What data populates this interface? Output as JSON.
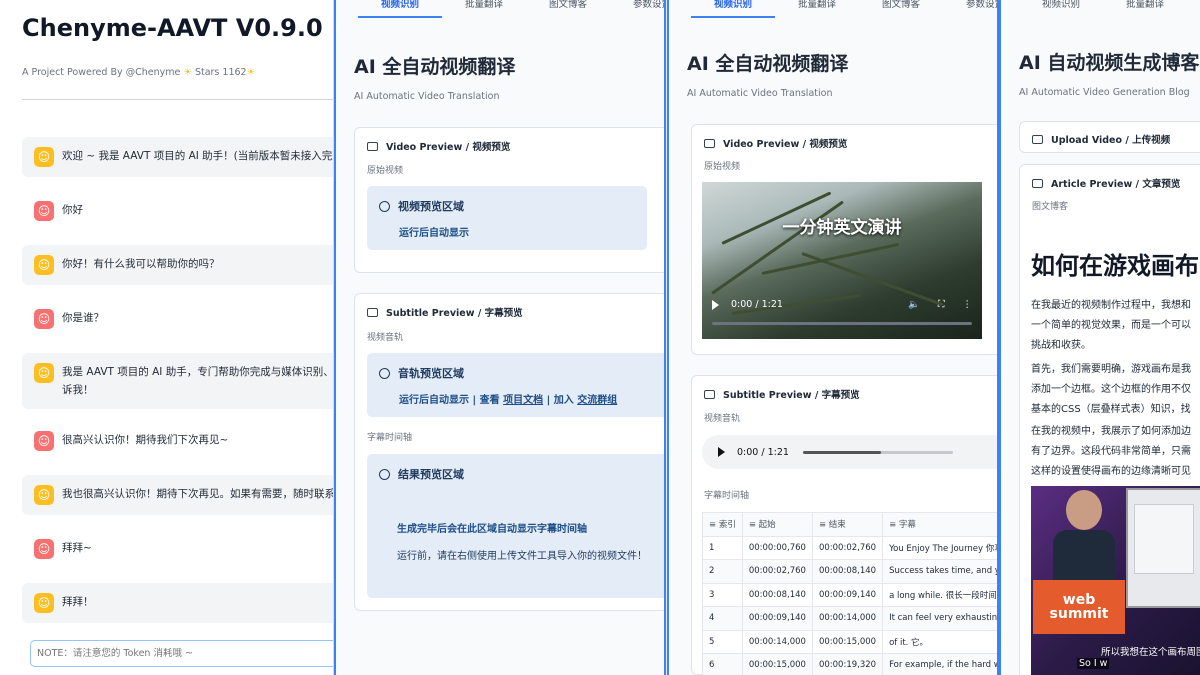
{
  "chat": {
    "app_title": "Chenyme-AAVT V0.9.0",
    "subtitle_prefix": "A Project Powered By @Chenyme",
    "star_glyph": "☀",
    "stars_text": "Stars 1162",
    "messages": [
      {
        "role": "bot",
        "text": "欢迎 ~ 我是 AAVT 项目的 AI 助手！(当前版本暂未接入完整"
      },
      {
        "role": "user",
        "text": "你好"
      },
      {
        "role": "bot",
        "text": "你好！有什么我可以帮助你的吗？"
      },
      {
        "role": "user",
        "text": "你是谁？"
      },
      {
        "role": "bot",
        "text": "我是 AAVT 项目的 AI 助手，专门帮助你完成与媒体识别、",
        "text2": "诉我！"
      },
      {
        "role": "user",
        "text": "很高兴认识你！期待我们下次再见~"
      },
      {
        "role": "bot",
        "text": "我也很高兴认识你！期待下次再见。如果有需要，随时联系"
      },
      {
        "role": "user",
        "text": "拜拜~"
      },
      {
        "role": "bot",
        "text": "拜拜！"
      }
    ],
    "input_placeholder": "NOTE：请注意您的 Token 消耗哦 ~"
  },
  "panel2": {
    "tabs": [
      "视频识别",
      "批量翻译",
      "图文博客",
      "参数设置"
    ],
    "title": "AI 全自动视频翻译",
    "subtitle": "AI Automatic Video Translation",
    "video_card": {
      "header": "Video Preview / 视频预览",
      "label": "原始视频",
      "box_title": "视频预览区域",
      "box_line": "运行后自动显示"
    },
    "subtitle_card": {
      "header": "Subtitle Preview / 字幕预览",
      "audio_label": "视频音轨",
      "audio_box_title": "音轨预览区域",
      "audio_line_a": "运行后自动显示 | 查看 ",
      "audio_link1": "项目文档",
      "audio_line_b": " | 加入 ",
      "audio_link2": "交流群组",
      "timeline_label": "字幕时间轴",
      "result_title": "结果预览区域",
      "result_line1": "生成完毕后会在此区域自动显示字幕时间轴",
      "result_line2": "运行前，请在右侧使用上传文件工具导入你的视频文件！"
    }
  },
  "panel3": {
    "tabs": [
      "视频识别",
      "批量翻译",
      "图文博客",
      "参数设置"
    ],
    "title": "AI 全自动视频翻译",
    "subtitle": "AI Automatic Video Translation",
    "video_card": {
      "header": "Video Preview / 视频预览",
      "label": "原始视频",
      "video_overlay": "一分钟英文演讲",
      "time": "0:00 / 1:21"
    },
    "subtitle_card": {
      "header": "Subtitle Preview / 字幕预览",
      "audio_label": "视频音轨",
      "audio_time": "0:00 / 1:21",
      "timeline_label": "字幕时间轴",
      "columns": [
        "索引",
        "起始",
        "结束",
        "字幕"
      ],
      "rows": [
        [
          "1",
          "00:00:00,760",
          "00:00:02,760",
          "You Enjoy The Journey 你享受"
        ],
        [
          "2",
          "00:00:02,760",
          "00:00:08,140",
          "Success takes time, and you ma"
        ],
        [
          "3",
          "00:00:08,140",
          "00:00:09,140",
          "a long while. 很长一段时间。"
        ],
        [
          "4",
          "00:00:09,140",
          "00:00:14,000",
          "It can feel very exhausting at ti"
        ],
        [
          "5",
          "00:00:14,000",
          "00:00:15,000",
          "of it. 它。"
        ],
        [
          "6",
          "00:00:15,000",
          "00:00:19,320",
          "For example, if the hard work s"
        ]
      ]
    }
  },
  "panel4": {
    "tabs": [
      "视频识别",
      "批量翻译"
    ],
    "title": "AI 自动视频生成博客",
    "subtitle": "AI Automatic Video Generation Blog",
    "upload_label": "Upload Video / 上传视频",
    "article_header": "Article Preview / 文章预览",
    "article_label": "图文博客",
    "article_heading": "如何在游戏画布",
    "paragraphs": [
      [
        "在我最近的视频制作过程中，我想和",
        "一个简单的视觉效果，而是一个可以",
        "挑战和收获。"
      ],
      [
        "首先，我们需要明确，游戏画布是我",
        "添加一个边框。这个边框的作用不仅",
        "基本的CSS（层叠样式表）知识，找"
      ],
      [
        "在我的视频中，我展示了如何添加边",
        "有了边界。这段代码非常简单，只需",
        "这样的设置使得画布的边缘清晰可见"
      ]
    ],
    "image_logo": "web summit",
    "image_caption_cn": "所以我想在这个画布周围",
    "image_caption_en": "So I w"
  }
}
